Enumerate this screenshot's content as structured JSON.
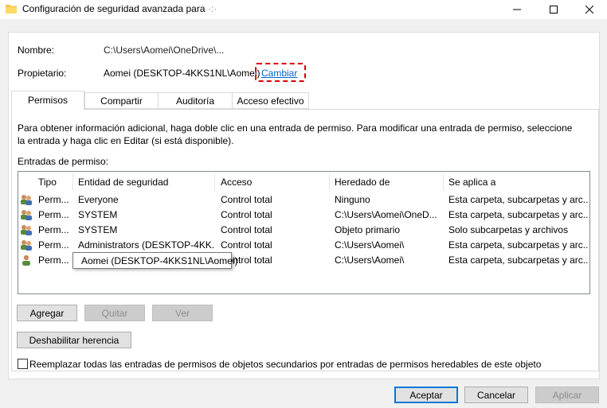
{
  "window": {
    "title": "Configuración de seguridad avanzada para",
    "title_suffix": "·:·",
    "minimize_icon": "minimize-icon",
    "maximize_icon": "maximize-icon",
    "close_icon": "close-icon"
  },
  "props": {
    "nombre_label": "Nombre:",
    "nombre_value": "C:\\Users\\Aomei\\OneDrive\\...",
    "propietario_label": "Propietario:",
    "propietario_value": "Aomei (DESKTOP-4KKS1NL\\Aomei)",
    "cambiar_link": "Cambiar"
  },
  "tabs": [
    {
      "label": "Permisos",
      "active": true
    },
    {
      "label": "Compartir",
      "active": false
    },
    {
      "label": "Auditoría",
      "active": false
    },
    {
      "label": "Acceso efectivo",
      "active": false
    }
  ],
  "info_text": "Para obtener información adicional, haga doble clic en una entrada de permiso. Para modificar una entrada de permiso, seleccione la entrada y haga clic en Editar (si está disponible).",
  "entries_label": "Entradas de permiso:",
  "table": {
    "columns": [
      "Tipo",
      "Entidad de seguridad",
      "Acceso",
      "Heredado de",
      "Se aplica a"
    ],
    "rows": [
      {
        "icon": "users-group-icon",
        "tipo": "Perm...",
        "entidad": "Everyone",
        "acceso": "Control total",
        "heredado": "Ninguno",
        "aplica": "Esta carpeta, subcarpetas y arc..."
      },
      {
        "icon": "users-group-icon",
        "tipo": "Perm...",
        "entidad": "SYSTEM",
        "acceso": "Control total",
        "heredado": "C:\\Users\\Aomei\\OneD...",
        "aplica": "Esta carpeta, subcarpetas y arc..."
      },
      {
        "icon": "users-group-icon",
        "tipo": "Perm...",
        "entidad": "SYSTEM",
        "acceso": "Control total",
        "heredado": "Objeto primario",
        "aplica": "Solo subcarpetas y archivos"
      },
      {
        "icon": "users-group-icon",
        "tipo": "Perm...",
        "entidad": "Administrators (DESKTOP-4KK...",
        "acceso": "Control total",
        "heredado": "C:\\Users\\Aomei\\",
        "aplica": "Esta carpeta, subcarpetas y arc..."
      },
      {
        "icon": "user-icon",
        "tipo": "Perm...",
        "entidad": "",
        "acceso": "Control total",
        "heredado": "C:\\Users\\Aomei\\",
        "aplica": "Esta carpeta, subcarpetas y arc..."
      }
    ],
    "tooltip": "Aomei (DESKTOP-4KKS1NL\\Aomei)"
  },
  "buttons": {
    "agregar": "Agregar",
    "quitar": "Quitar",
    "ver": "Ver",
    "deshabilitar": "Deshabilitar herencia",
    "aceptar": "Aceptar",
    "cancelar": "Cancelar",
    "aplicar": "Aplicar"
  },
  "replace_checkbox": {
    "label": "Reemplazar todas las entradas de permisos de objetos secundarios por entradas de permisos heredables de este objeto",
    "checked": false
  },
  "colors": {
    "accent": "#0078d7",
    "link": "#0066cc",
    "highlight_box": "#d80000"
  }
}
